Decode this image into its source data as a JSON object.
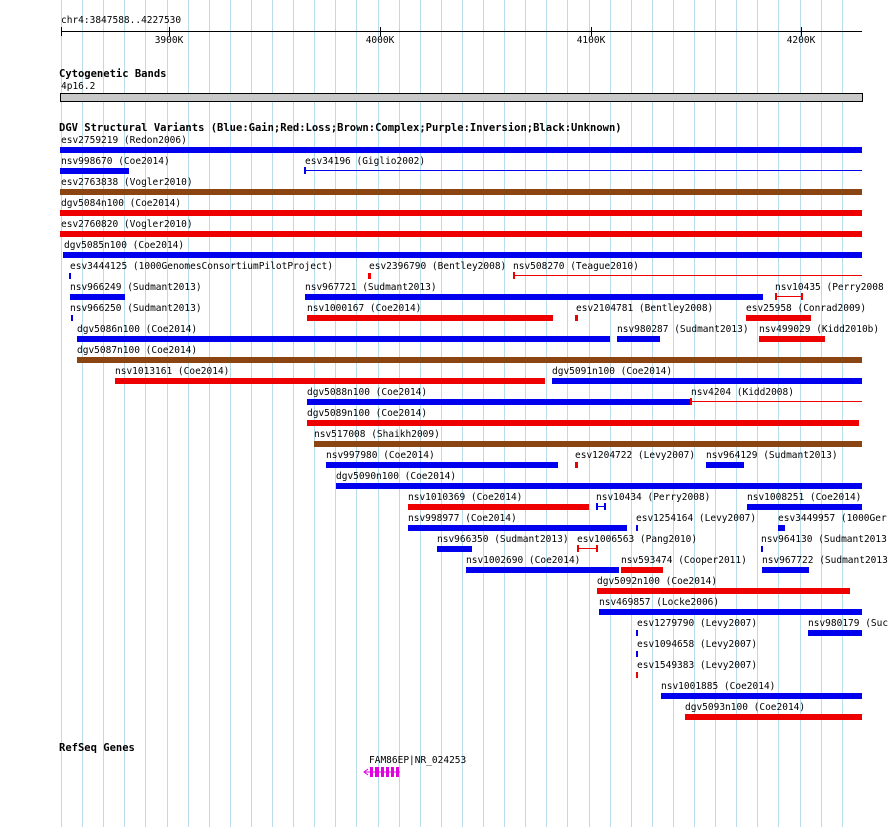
{
  "coord_label": "chr4:3847588..4227530",
  "ruler_ticks": [
    "3900K",
    "4000K",
    "4100K",
    "4200K"
  ],
  "cytoband": {
    "title": "Cytogenetic Bands",
    "band": "4p16.2"
  },
  "dgv_title": "DGV Structural Variants (Blue:Gain;Red:Loss;Brown:Complex;Purple:Inversion;Black:Unknown)",
  "refseq": {
    "title": "RefSeq Genes",
    "gene_label": "FAM86EP|NR_024253"
  },
  "colors": {
    "gain": "#0000ee",
    "loss": "#ee0000",
    "complex": "#8b4513",
    "grid": "#b9dcea",
    "gene": "#e000e0"
  },
  "variants": [
    "esv2759219 (Redon2006)",
    "nsv998670 (Coe2014)",
    "esv34196 (Giglio2002)",
    "esv2763838 (Vogler2010)",
    "dgv5084n100 (Coe2014)",
    "esv2760820 (Vogler2010)",
    "dgv5085n100 (Coe2014)",
    "esv3444125 (1000GenomesConsortiumPilotProject)",
    "esv2396790 (Bentley2008)",
    "nsv508270 (Teague2010)",
    "nsv966249 (Sudmant2013)",
    "nsv967721 (Sudmant2013)",
    "nsv10435 (Perry2008",
    "nsv966250 (Sudmant2013)",
    "nsv1000167 (Coe2014)",
    "esv2104781 (Bentley2008)",
    "esv25958 (Conrad2009)",
    "dgv5086n100 (Coe2014)",
    "nsv980287 (Sudmant2013)",
    "nsv499029 (Kidd2010b)",
    "dgv5087n100 (Coe2014)",
    "nsv1013161 (Coe2014)",
    "dgv5091n100 (Coe2014)",
    "dgv5088n100 (Coe2014)",
    "nsv4204 (Kidd2008)",
    "dgv5089n100 (Coe2014)",
    "nsv517008 (Shaikh2009)",
    "nsv997980 (Coe2014)",
    "esv1204722 (Levy2007)",
    "nsv964129 (Sudmant2013)",
    "dgv5090n100 (Coe2014)",
    "nsv1010369 (Coe2014)",
    "nsv10434 (Perry2008)",
    "nsv1008251 (Coe2014)",
    "nsv998977 (Coe2014)",
    "esv1254164 (Levy2007)",
    "esv3449957 (1000Ger",
    "nsv966350 (Sudmant2013)",
    "esv1006563 (Pang2010)",
    "nsv964130 (Sudmant2013",
    "nsv1002690 (Coe2014)",
    "nsv593474 (Cooper2011)",
    "nsv967722 (Sudmant2013",
    "dgv5092n100 (Coe2014)",
    "nsv469857 (Locke2006)",
    "esv1279790 (Levy2007)",
    "nsv980179 (Suc",
    "esv1094658 (Levy2007)",
    "esv1549383 (Levy2007)",
    "nsv1001885 (Coe2014)",
    "dgv5093n100 (Coe2014)"
  ]
}
